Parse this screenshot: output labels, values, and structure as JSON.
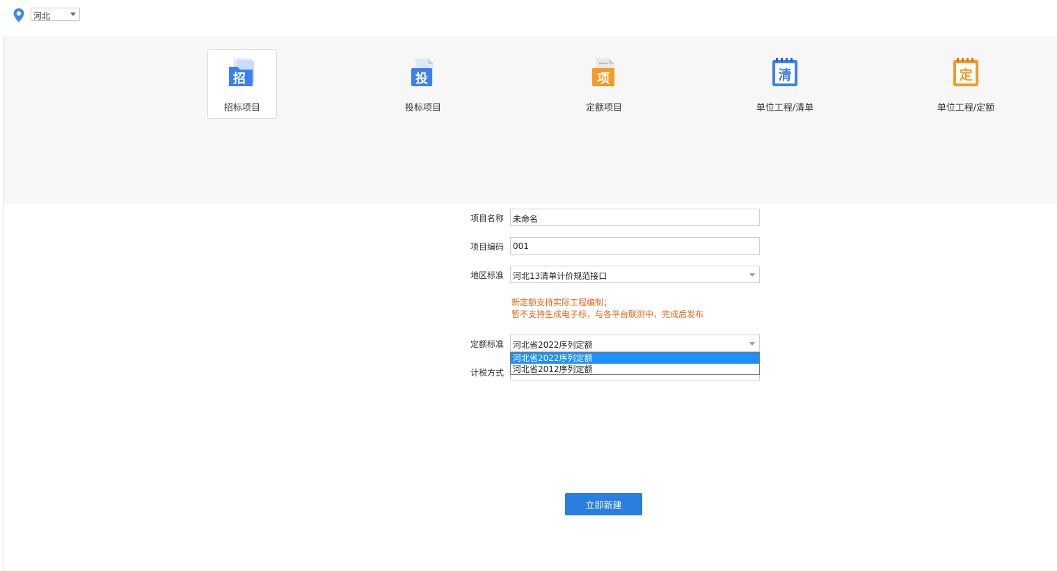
{
  "region": {
    "selected": "河北"
  },
  "project_types": [
    {
      "label": "招标项目",
      "glyph": "招",
      "icon": "zhao-doc-icon",
      "color": "#3d7ff0",
      "active": true
    },
    {
      "label": "投标项目",
      "glyph": "投",
      "icon": "tou-doc-icon",
      "color": "#3d7ff0",
      "active": false
    },
    {
      "label": "定额项目",
      "glyph": "项",
      "icon": "xiang-doc-icon",
      "color": "#f59a23",
      "active": false
    },
    {
      "label": "单位工程/清单",
      "glyph": "清",
      "icon": "qing-notebook-icon",
      "color": "#3d7ff0",
      "active": false
    },
    {
      "label": "单位工程/定额",
      "glyph": "定",
      "icon": "ding-notebook-icon",
      "color": "#f59a23",
      "active": false
    }
  ],
  "form": {
    "project_name": {
      "label": "项目名称",
      "value": "未命名"
    },
    "project_code": {
      "label": "项目编码",
      "value": "001"
    },
    "region_standard": {
      "label": "地区标准",
      "value": "河北13清单计价规范接口"
    },
    "notice": {
      "line1": "新定额支持实际工程编制；",
      "line2": "暂不支持生成电子标，与各平台联测中，完成后发布"
    },
    "quota_standard": {
      "label": "定额标准",
      "value": "河北省2022序列定额",
      "options": [
        "河北省2022序列定额",
        "河北省2012序列定额"
      ]
    },
    "tax_method": {
      "label": "计税方式",
      "value": ""
    }
  },
  "actions": {
    "create_label": "立即新建"
  },
  "colors": {
    "primary": "#2b7de0",
    "notice": "#e06a1c",
    "selected_option": "#1e90ff"
  }
}
